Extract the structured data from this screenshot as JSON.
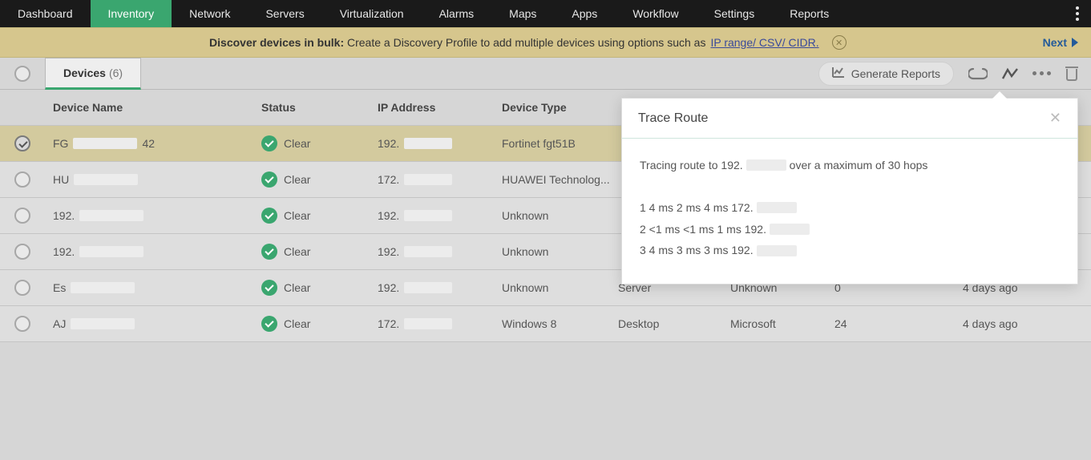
{
  "nav": {
    "items": [
      "Dashboard",
      "Inventory",
      "Network",
      "Servers",
      "Virtualization",
      "Alarms",
      "Maps",
      "Apps",
      "Workflow",
      "Settings",
      "Reports"
    ],
    "active": 1
  },
  "tip": {
    "bold": "Discover devices in bulk:",
    "text": "Create a Discovery Profile to add multiple devices using options such as",
    "link": "IP range/ CSV/ CIDR.",
    "next": "Next"
  },
  "devices_tab": {
    "label": "Devices",
    "count": "(6)"
  },
  "toolbar": {
    "generate_reports": "Generate Reports"
  },
  "columns": {
    "name": "Device Name",
    "status": "Status",
    "ip": "IP Address",
    "type": "Device Type",
    "category": "",
    "vendor": "",
    "interfaces": "",
    "added": ""
  },
  "rows": [
    {
      "selected": true,
      "name_pre": "FG",
      "name_suf": "42",
      "status": "Clear",
      "ip_pre": "192.",
      "type": "Fortinet fgt51B",
      "category": "",
      "vendor": "",
      "interfaces": "",
      "added": ""
    },
    {
      "selected": false,
      "name_pre": "HU",
      "name_suf": "",
      "status": "Clear",
      "ip_pre": "172.",
      "type": "HUAWEI Technolog...",
      "category": "",
      "vendor": "",
      "interfaces": "",
      "added": ""
    },
    {
      "selected": false,
      "name_pre": "192.",
      "name_suf": "",
      "status": "Clear",
      "ip_pre": "192.",
      "type": "Unknown",
      "category": "",
      "vendor": "",
      "interfaces": "",
      "added": ""
    },
    {
      "selected": false,
      "name_pre": "192.",
      "name_suf": "",
      "status": "Clear",
      "ip_pre": "192.",
      "type": "Unknown",
      "category": "",
      "vendor": "",
      "interfaces": "",
      "added": ""
    },
    {
      "selected": false,
      "name_pre": "Es",
      "name_suf": "",
      "status": "Clear",
      "ip_pre": "192.",
      "type": "Unknown",
      "category": "Server",
      "vendor": "Unknown",
      "interfaces": "0",
      "added": "4 days ago"
    },
    {
      "selected": false,
      "name_pre": "AJ",
      "name_suf": "",
      "status": "Clear",
      "ip_pre": "172.",
      "type": "Windows 8",
      "category": "Desktop",
      "vendor": "Microsoft",
      "interfaces": "24",
      "added": "4 days ago"
    }
  ],
  "popover": {
    "title": "Trace Route",
    "intro_pre": "Tracing route to 192.",
    "intro_post": "over a maximum of 30 hops",
    "hops": [
      {
        "pre": "1 4 ms 2 ms 4 ms 172."
      },
      {
        "pre": "2 <1 ms <1 ms 1 ms 192."
      },
      {
        "pre": "3 4 ms 3 ms 3 ms 192."
      }
    ]
  }
}
